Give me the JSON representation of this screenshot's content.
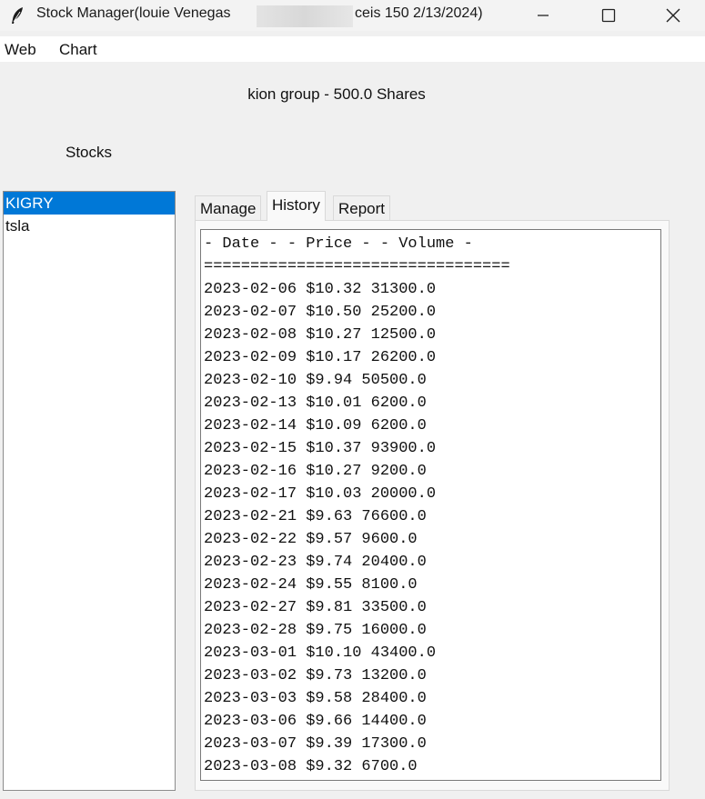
{
  "window": {
    "title_left": "Stock Manager(louie Venegas",
    "title_right": "ceis 150 2/13/2024)",
    "minimize_glyph": "─",
    "maximize_glyph": "☐",
    "close_glyph": "✕"
  },
  "menu": {
    "items": [
      {
        "label": "Web"
      },
      {
        "label": "Chart"
      }
    ]
  },
  "header": {
    "label": "kion group - 500.0 Shares"
  },
  "stocks": {
    "label": "Stocks",
    "items": [
      {
        "label": "KIGRY",
        "selected": true
      },
      {
        "label": "tsla",
        "selected": false
      }
    ]
  },
  "tabs": [
    {
      "label": "Manage",
      "active": false
    },
    {
      "label": "History",
      "active": true
    },
    {
      "label": "Report",
      "active": false
    }
  ],
  "history": {
    "header_line": "- Date - - Price - - Volume -",
    "separator_line": "=================================",
    "rows": [
      "2023-02-06 $10.32 31300.0",
      "2023-02-07 $10.50 25200.0",
      "2023-02-08 $10.27 12500.0",
      "2023-02-09 $10.17 26200.0",
      "2023-02-10 $9.94 50500.0",
      "2023-02-13 $10.01 6200.0",
      "2023-02-14 $10.09 6200.0",
      "2023-02-15 $10.37 93900.0",
      "2023-02-16 $10.27 9200.0",
      "2023-02-17 $10.03 20000.0",
      "2023-02-21 $9.63 76600.0",
      "2023-02-22 $9.57 9600.0",
      "2023-02-23 $9.74 20400.0",
      "2023-02-24 $9.55 8100.0",
      "2023-02-27 $9.81 33500.0",
      "2023-02-28 $9.75 16000.0",
      "2023-03-01 $10.10 43400.0",
      "2023-03-02 $9.73 13200.0",
      "2023-03-03 $9.58 28400.0",
      "2023-03-06 $9.66 14400.0",
      "2023-03-07 $9.39 17300.0",
      "2023-03-08 $9.32 6700.0"
    ]
  },
  "colors": {
    "selection": "#0078d7",
    "window_bg": "#f0f0f0"
  }
}
